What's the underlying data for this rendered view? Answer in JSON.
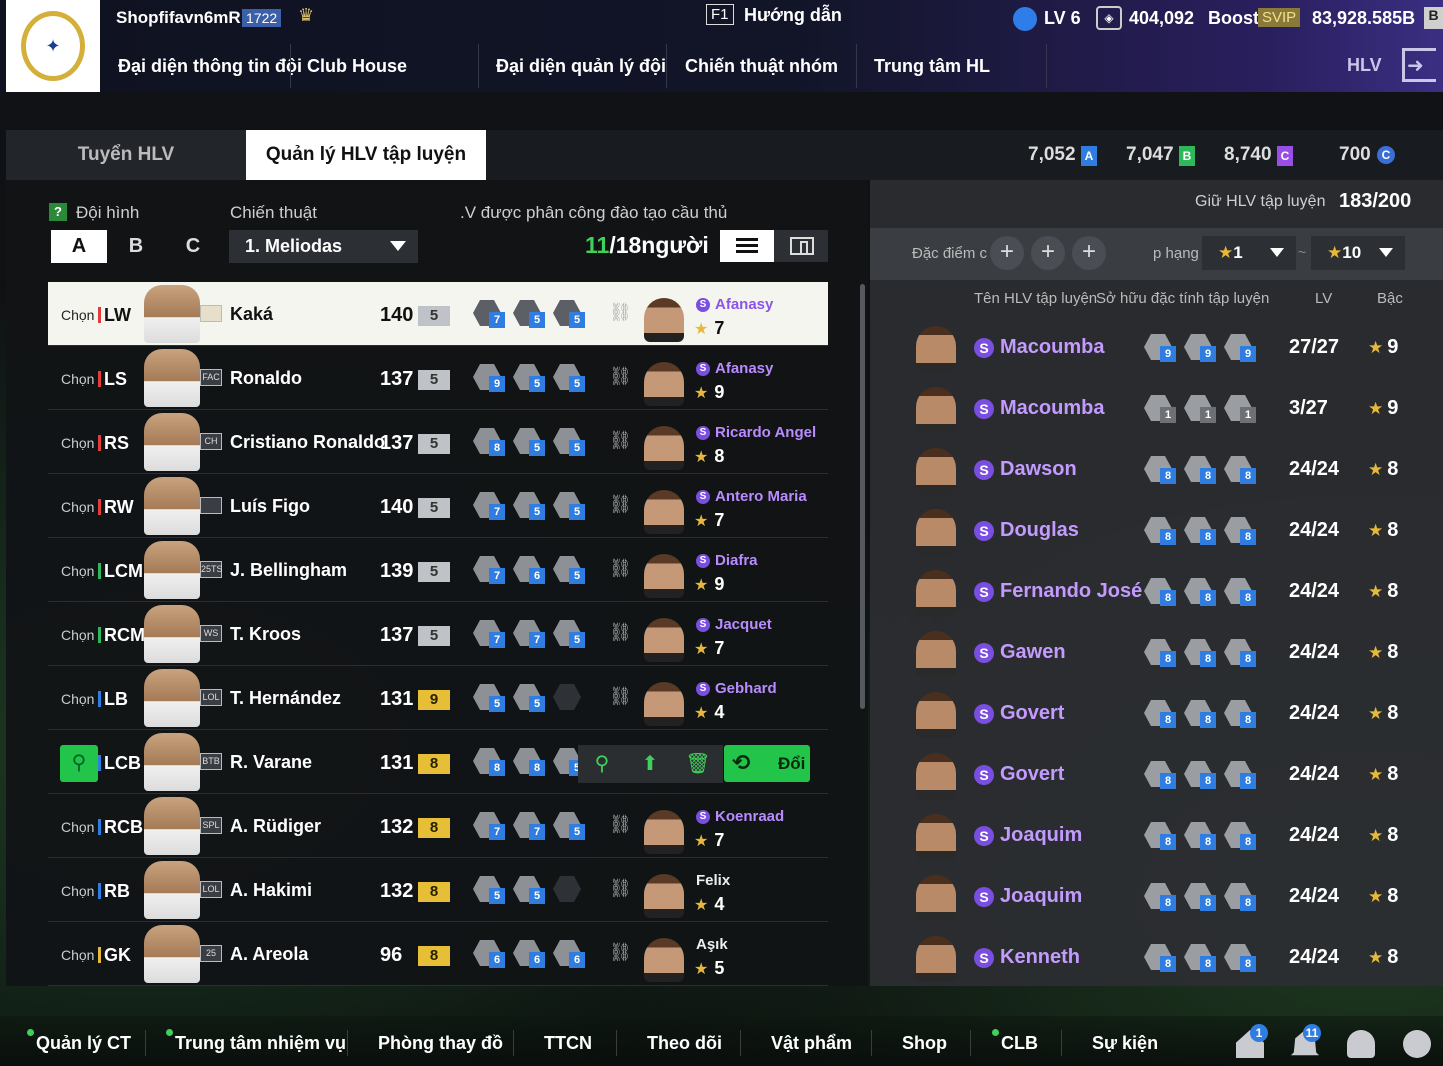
{
  "header": {
    "username": "Shopfifavn6mR",
    "ovr": "1722",
    "f1_key": "F1",
    "guide_label": "Hướng dẫn",
    "level": "LV 6",
    "coins": "404,092",
    "boost_label": "Boost",
    "svip_label": "SVIP",
    "bp": "83,928.585B",
    "bp_suffix": "B",
    "nav": [
      "Đại diện thông tin đội",
      "Club House",
      "Đại diện quản lý đội",
      "Chiến thuật nhóm",
      "Trung tâm HL"
    ],
    "hlv_label": "HLV"
  },
  "tabs": {
    "recruit": "Tuyển HLV",
    "manage": "Quản lý HLV tập luyện"
  },
  "resources": [
    {
      "value": "7,052",
      "letter": "A",
      "color": "#2f7de0"
    },
    {
      "value": "7,047",
      "letter": "B",
      "color": "#2fb85a"
    },
    {
      "value": "8,740",
      "letter": "C",
      "color": "#9a4ee8"
    },
    {
      "value": "700",
      "letter": "C",
      "color": "#3a6fd6"
    }
  ],
  "left": {
    "squad_label": "Đội hình",
    "squad_options": [
      "A",
      "B",
      "C"
    ],
    "tactic_label": "Chiến thuật",
    "tactic_value": "1. Meliodas",
    "assigned_label": ".V được phân công đào tạo cầu thủ",
    "assigned_count": "11",
    "assigned_total": "/18người",
    "rows": [
      {
        "chon": "Chọn",
        "pos": "LW",
        "season": "",
        "name": "Kaká",
        "ovr": "140",
        "grade": "5",
        "traits": [
          "7",
          "5",
          "5"
        ],
        "coach": "Afanasy",
        "stars": "7",
        "coach_s": true
      },
      {
        "chon": "Chọn",
        "pos": "LS",
        "season": "FAC",
        "name": "Ronaldo",
        "ovr": "137",
        "grade": "5",
        "traits": [
          "9",
          "5",
          "5"
        ],
        "coach": "Afanasy",
        "stars": "9",
        "coach_s": true
      },
      {
        "chon": "Chọn",
        "pos": "RS",
        "season": "CH",
        "name": "Cristiano Ronaldo",
        "ovr": "137",
        "grade": "5",
        "traits": [
          "8",
          "5",
          "5"
        ],
        "coach": "Ricardo Angel",
        "stars": "8",
        "coach_s": true
      },
      {
        "chon": "Chọn",
        "pos": "RW",
        "season": "",
        "name": "Luís Figo",
        "ovr": "140",
        "grade": "5",
        "traits": [
          "7",
          "5",
          "5"
        ],
        "coach": "Antero Maria",
        "stars": "7",
        "coach_s": true
      },
      {
        "chon": "Chọn",
        "pos": "LCM",
        "season": "25TS",
        "name": "J. Bellingham",
        "ovr": "139",
        "grade": "5",
        "traits": [
          "7",
          "6",
          "5"
        ],
        "coach": "Diafra",
        "stars": "9",
        "coach_s": true
      },
      {
        "chon": "Chọn",
        "pos": "RCM",
        "season": "WS",
        "name": "T. Kroos",
        "ovr": "137",
        "grade": "5",
        "traits": [
          "7",
          "7",
          "5"
        ],
        "coach": "Jacquet",
        "stars": "7",
        "coach_s": true
      },
      {
        "chon": "Chọn",
        "pos": "LB",
        "season": "LOL",
        "name": "T. Hernández",
        "ovr": "131",
        "grade": "9",
        "traits": [
          "5",
          "5",
          ""
        ],
        "coach": "Gebhard",
        "stars": "4",
        "coach_s": true
      },
      {
        "chon": "",
        "pos": "LCB",
        "season": "BTB",
        "name": "R. Varane",
        "ovr": "131",
        "grade": "8",
        "traits": [
          "8",
          "8",
          "5"
        ],
        "coach": "",
        "stars": "",
        "coach_s": false
      },
      {
        "chon": "Chọn",
        "pos": "RCB",
        "season": "SPL",
        "name": "A. Rüdiger",
        "ovr": "132",
        "grade": "8",
        "traits": [
          "7",
          "7",
          "5"
        ],
        "coach": "Koenraad",
        "stars": "7",
        "coach_s": true
      },
      {
        "chon": "Chọn",
        "pos": "RB",
        "season": "LOL",
        "name": "A. Hakimi",
        "ovr": "132",
        "grade": "8",
        "traits": [
          "5",
          "5",
          ""
        ],
        "coach": "Felix",
        "stars": "4",
        "coach_s": false
      },
      {
        "chon": "Chọn",
        "pos": "GK",
        "season": "25",
        "name": "A. Areola",
        "ovr": "96",
        "grade": "8",
        "traits": [
          "6",
          "6",
          "6"
        ],
        "coach": "Aşık",
        "stars": "5",
        "coach_s": false
      }
    ],
    "swap_label": "Đổi"
  },
  "right": {
    "hold_label": "Giữ HLV tập luyện",
    "hold_value": "183/200",
    "trait_filter_label": "Đặc điểm c",
    "rank_filter_label": "p hạng",
    "rank_min": "1",
    "rank_max": "10",
    "col_name": "Tên HLV tập luyện",
    "col_traits": "Sở hữu đặc tính tập luyện",
    "col_lv": "LV",
    "col_rank": "Bậc",
    "coaches": [
      {
        "name": "Macoumba",
        "traits": [
          "9",
          "9",
          "9"
        ],
        "lv": "27/27",
        "rank": "9",
        "grey": false
      },
      {
        "name": "Macoumba",
        "traits": [
          "1",
          "1",
          "1"
        ],
        "lv": "3/27",
        "rank": "9",
        "grey": true
      },
      {
        "name": "Dawson",
        "traits": [
          "8",
          "8",
          "8"
        ],
        "lv": "24/24",
        "rank": "8",
        "grey": false
      },
      {
        "name": "Douglas",
        "traits": [
          "8",
          "8",
          "8"
        ],
        "lv": "24/24",
        "rank": "8",
        "grey": false
      },
      {
        "name": "Fernando José",
        "traits": [
          "8",
          "8",
          "8"
        ],
        "lv": "24/24",
        "rank": "8",
        "grey": false
      },
      {
        "name": "Gawen",
        "traits": [
          "8",
          "8",
          "8"
        ],
        "lv": "24/24",
        "rank": "8",
        "grey": false
      },
      {
        "name": "Govert",
        "traits": [
          "8",
          "8",
          "8"
        ],
        "lv": "24/24",
        "rank": "8",
        "grey": false
      },
      {
        "name": "Govert",
        "traits": [
          "8",
          "8",
          "8"
        ],
        "lv": "24/24",
        "rank": "8",
        "grey": false
      },
      {
        "name": "Joaquim",
        "traits": [
          "8",
          "8",
          "8"
        ],
        "lv": "24/24",
        "rank": "8",
        "grey": false
      },
      {
        "name": "Joaquim",
        "traits": [
          "8",
          "8",
          "8"
        ],
        "lv": "24/24",
        "rank": "8",
        "grey": false
      },
      {
        "name": "Kenneth",
        "traits": [
          "8",
          "8",
          "8"
        ],
        "lv": "24/24",
        "rank": "8",
        "grey": false
      }
    ]
  },
  "bottom_nav": {
    "items": [
      "Quản lý CT",
      "Trung tâm nhiệm vụ",
      "Phòng thay đồ",
      "TTCN",
      "Theo dõi",
      "Vật phẩm",
      "Shop",
      "CLB",
      "Sự kiện"
    ],
    "badges": [
      "1",
      "11"
    ]
  }
}
